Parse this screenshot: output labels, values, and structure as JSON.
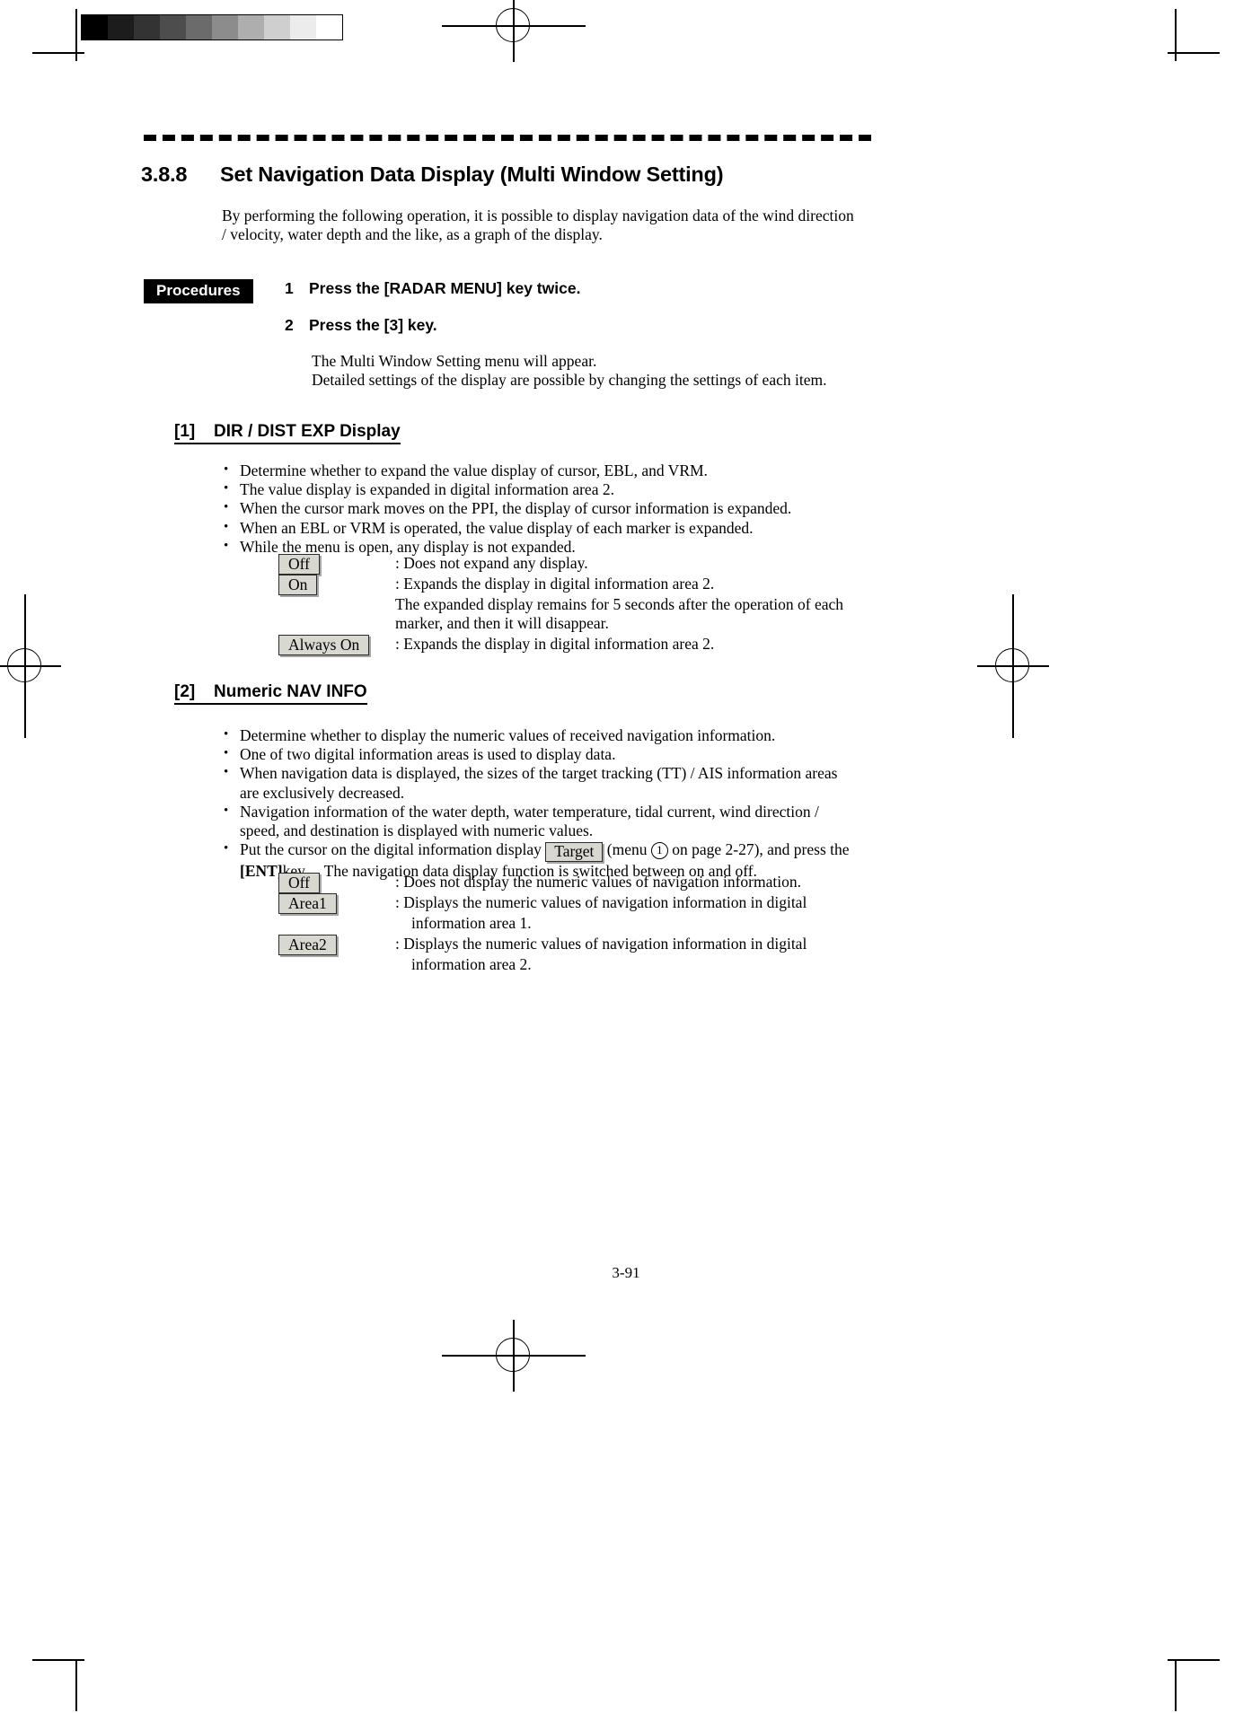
{
  "page": {
    "number": "3-91",
    "grayscale_steps": [
      "#000000",
      "#1c1c1c",
      "#333333",
      "#4d4d4d",
      "#6b6b6b",
      "#8c8c8c",
      "#aeaeae",
      "#cfcfcf",
      "#ececec",
      "#ffffff"
    ]
  },
  "section": {
    "number": "3.8.8",
    "title": "Set Navigation Data Display (Multi Window Setting)",
    "intro": "By performing the following operation, it is possible to display navigation data of the wind direction / velocity, water depth and the like, as a graph of the display."
  },
  "procedures": {
    "badge": "Procedures",
    "steps": [
      {
        "num": "1",
        "text": "Press the [RADAR MENU] key twice."
      },
      {
        "num": "2",
        "text": "Press the [3] key."
      }
    ],
    "note_line1": "The Multi Window Setting menu will appear.",
    "note_line2": "Detailed settings of the display are possible by changing the settings of each item."
  },
  "block1": {
    "tag": "[1]",
    "title": "DIR / DIST EXP Display",
    "bullets": [
      "Determine whether to expand the value display of cursor, EBL, and VRM.",
      "The value display is expanded in digital information area 2.",
      "When the cursor mark moves on the PPI, the display of cursor information is expanded.",
      "When an EBL or VRM is operated, the value display of each marker is expanded.",
      "While the menu is open, any display is not expanded."
    ],
    "options": [
      {
        "label": "Off",
        "desc": ": Does not expand any display.",
        "cont": ""
      },
      {
        "label": "On",
        "desc": ": Expands the display in digital information area 2.",
        "cont": "The expanded display remains for 5 seconds after the operation of each marker, and then it will disappear."
      },
      {
        "label": "Always On",
        "desc": ": Expands the display in digital information area 2.",
        "cont": ""
      }
    ]
  },
  "block2": {
    "tag": "[2]",
    "title": "Numeric NAV INFO",
    "bullets": [
      "Determine whether to display the numeric values of received navigation information.",
      "One of two digital information areas is used to display data.",
      "When navigation data is displayed, the sizes of the target tracking (TT) / AIS information areas are exclusively decreased.",
      "Navigation information of the water depth, water temperature, tidal current, wind direction / speed, and destination is displayed with numeric values."
    ],
    "last_bullet": {
      "pre": "Put the cursor on the digital information display",
      "button": "Target",
      "mid_open": "(menu",
      "circled": "1",
      "mid_close": "on page 2-27), and press the",
      "ent_key": "[ENT]",
      "post": "key. The navigation data display function is switched between on and off."
    },
    "options": [
      {
        "label": "Off",
        "desc": ": Does not display the numeric values of navigation information.",
        "cont": ""
      },
      {
        "label": "Area1",
        "desc": ": Displays the numeric values of navigation information in digital",
        "cont": "information area 1."
      },
      {
        "label": "Area2",
        "desc": ": Displays the numeric values of navigation information in digital",
        "cont": "information area 2."
      }
    ]
  }
}
